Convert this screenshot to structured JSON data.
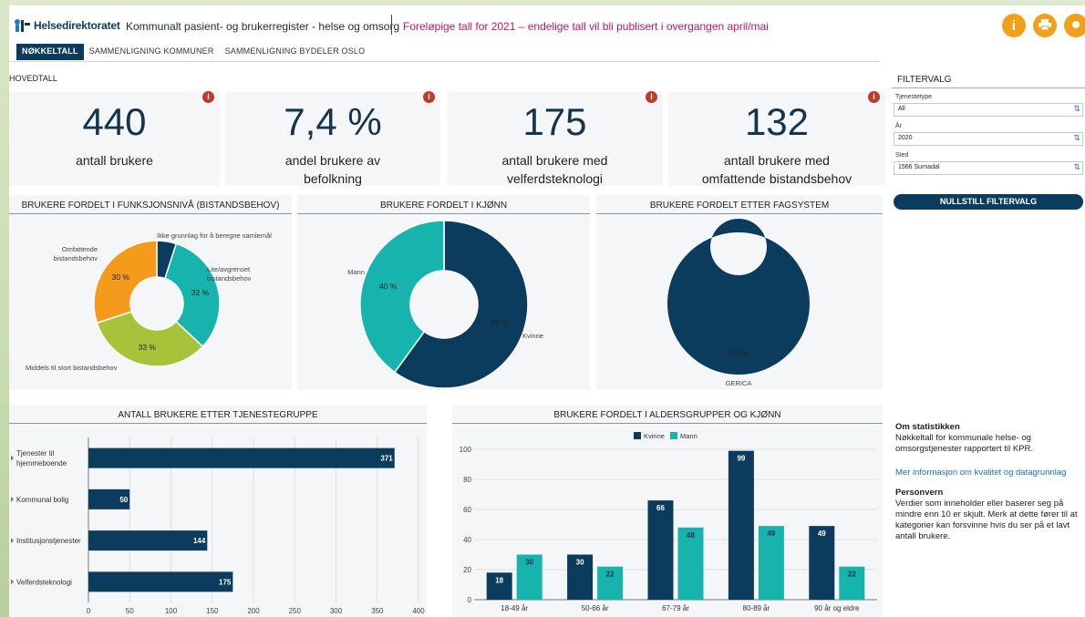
{
  "header": {
    "logo_text": "Helsedirektoratet",
    "app_title": "Kommunalt pasient- og brukerregister - helse og omsorg",
    "notice": "Foreløpige tall for 2021 – endelige tall vil bli publisert i overgangen april/mai",
    "buttons": [
      {
        "icon": "info-icon",
        "glyph": "i"
      },
      {
        "icon": "print-icon",
        "glyph": "▬"
      },
      {
        "icon": "share-icon",
        "glyph": "●"
      }
    ]
  },
  "tabs": [
    {
      "label": "NØKKELTALL",
      "active": true
    },
    {
      "label": "SAMMENLIGNING KOMMUNER",
      "active": false
    },
    {
      "label": "SAMMENLIGNING BYDELER OSLO",
      "active": false
    }
  ],
  "hovedtall": {
    "title": "HOVEDTALL",
    "kpis": [
      {
        "value": "440",
        "label_1": "antall brukere",
        "label_2": ""
      },
      {
        "value": "7,4 %",
        "label_1": "andel brukere av",
        "label_2": "befolkning"
      },
      {
        "value": "175",
        "label_1": "antall brukere med",
        "label_2": "velferdsteknologi"
      },
      {
        "value": "132",
        "label_1": "antall brukere med",
        "label_2": "omfattende bistandsbehov"
      }
    ],
    "info_glyph": "i"
  },
  "filters": {
    "title": "FILTERVALG",
    "fields": [
      {
        "label": "Tjenestetype",
        "value": "All"
      },
      {
        "label": "År",
        "value": "2020"
      },
      {
        "label": "Sted",
        "value": "1566 Surnadal"
      }
    ],
    "reset_label": "NULLSTILL FILTERVALG"
  },
  "about": {
    "title": "Om statistikken",
    "text_1": "Nøkkeltall for kommunale helse- og",
    "text_2": "omsorgstjenester rapportert til KPR.",
    "link": "Mer informasjon om kvalitet og datagrunnlag",
    "privacy_title": "Personvern",
    "privacy_1": "Verdier som inneholder eller baserer seg på",
    "privacy_2": "mindre enn 10 er skjult. Merk at dette fører til at",
    "privacy_3": "kategorier kan forsvinne hvis du ser på et lavt",
    "privacy_4": "antall brukere."
  },
  "colors": {
    "navy": "#0b3c5d",
    "teal": "#17b3ad",
    "orange": "#f59a1b",
    "green": "#a6c33a",
    "dark": "#14344f"
  },
  "chart_data": [
    {
      "type": "pie",
      "title": "BRUKERE FORDELT I FUNKSJONSNIVÅ (BISTANDSBEHOV)",
      "slices": [
        {
          "label": "Ikke grunnlag for å beregne samlemål",
          "value": 5,
          "value_label": "",
          "color": "#0b3c5d"
        },
        {
          "label": "Lite/avgrenset bistandsbehov",
          "value": 32,
          "value_label": "32 %",
          "color": "#17b3ad"
        },
        {
          "label": "Middels til stort bistandsbehov",
          "value": 33,
          "value_label": "33 %",
          "color": "#a6c33a"
        },
        {
          "label": "Omfattende bistandsbehov",
          "value": 30,
          "value_label": "30 %",
          "color": "#f59a1b"
        }
      ]
    },
    {
      "type": "pie",
      "title": "BRUKERE FORDELT I KJØNN",
      "slices": [
        {
          "label": "Kvinne",
          "value": 60,
          "value_label": "60 %",
          "color": "#0b3c5d"
        },
        {
          "label": "Mann",
          "value": 40,
          "value_label": "40 %",
          "color": "#17b3ad"
        }
      ]
    },
    {
      "type": "pie",
      "title": "BRUKERE FORDELT ETTER FAGSYSTEM",
      "slices": [
        {
          "label": "GERICA",
          "value": 100,
          "value_label": "100 %",
          "color": "#0b3c5d"
        }
      ]
    },
    {
      "type": "bar",
      "orientation": "horizontal",
      "title": "ANTALL BRUKERE ETTER TJENESTEGRUPPE",
      "categories": [
        "Tjenester til hjemmeboende",
        "Kommunal bolig",
        "Institusjonstjenester",
        "Velferdsteknologi"
      ],
      "category_lines": [
        [
          "Tjenester til",
          "hjemmeboende"
        ],
        [
          "Kommunal bolig"
        ],
        [
          "Institusjonstjenester"
        ],
        [
          "Velferdsteknologi"
        ]
      ],
      "values": [
        371,
        50,
        144,
        175
      ],
      "xlim": [
        0,
        400
      ],
      "xticks": [
        0,
        50,
        100,
        150,
        200,
        250,
        300,
        350,
        400
      ],
      "color": "#0b3c5d"
    },
    {
      "type": "bar",
      "title": "BRUKERE FORDELT I ALDERSGRUPPER OG KJØNN",
      "categories": [
        "18-49 år",
        "50-66 år",
        "67-79 år",
        "80-89 år",
        "90 år og eldre"
      ],
      "series": [
        {
          "name": "Kvinne",
          "values": [
            18,
            30,
            66,
            99,
            49
          ],
          "color": "#0b3c5d"
        },
        {
          "name": "Mann",
          "values": [
            30,
            22,
            48,
            49,
            22
          ],
          "color": "#17b3ad"
        }
      ],
      "ylim": [
        0,
        100
      ],
      "yticks": [
        0,
        20,
        40,
        60,
        80,
        100
      ],
      "legend": "top"
    }
  ]
}
